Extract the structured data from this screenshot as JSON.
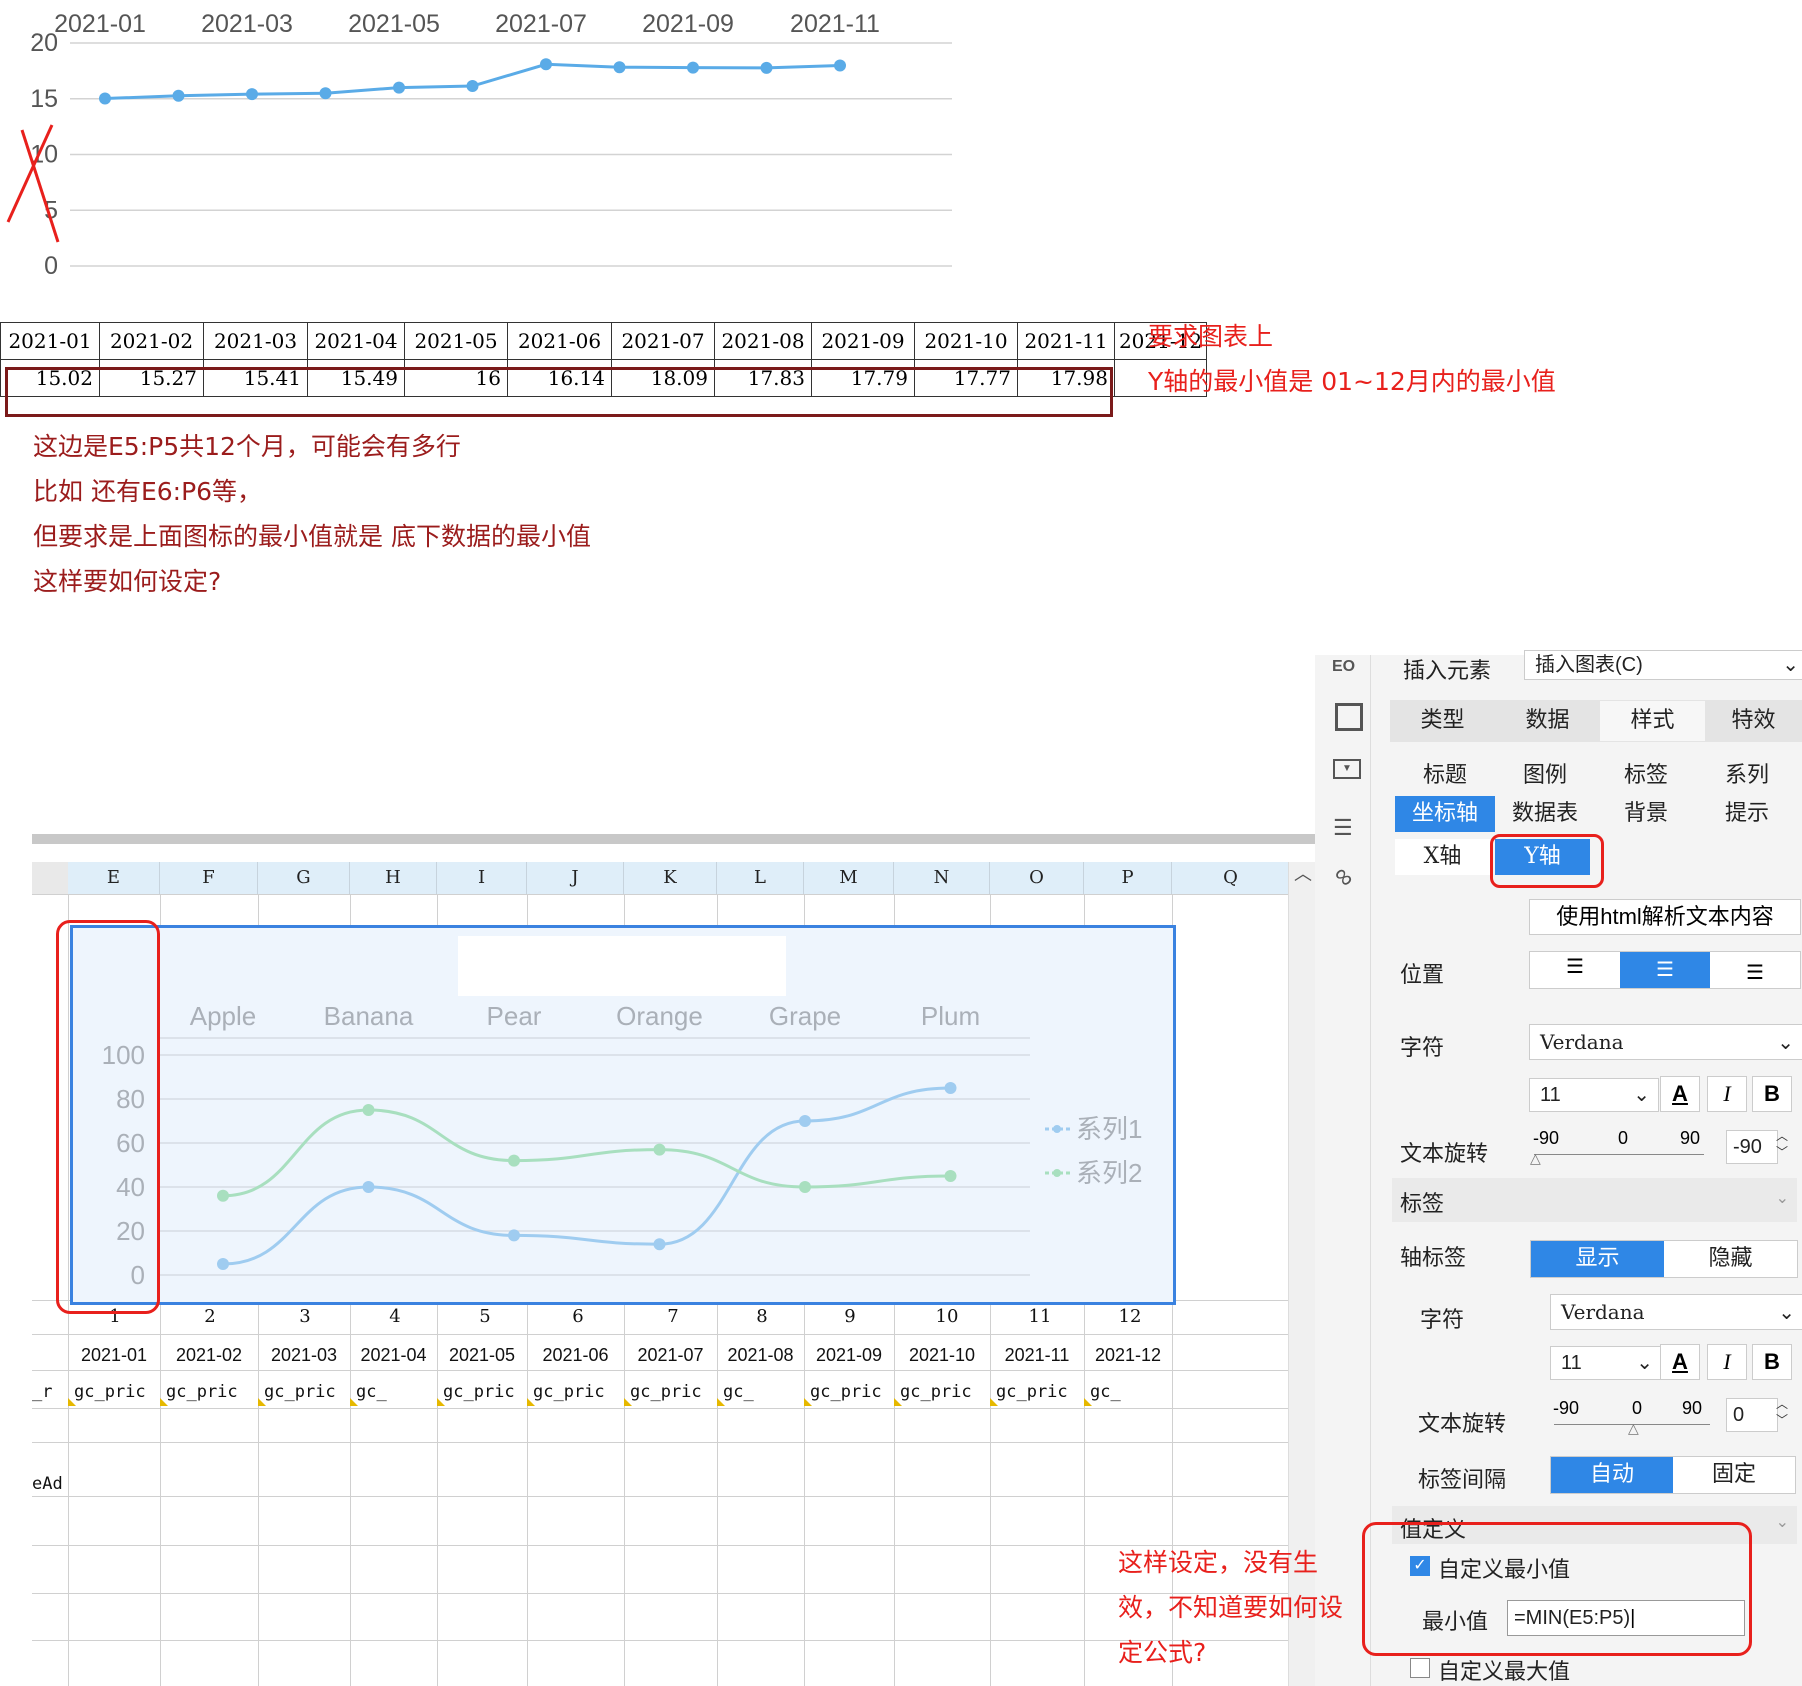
{
  "top_chart": {
    "x_tick_labels": [
      "2021-01",
      "2021-03",
      "2021-05",
      "2021-07",
      "2021-09",
      "2021-11"
    ],
    "y_tick_labels": [
      "20",
      "15",
      "10",
      "5",
      "0"
    ],
    "bottom_numbers": [
      "1",
      "2",
      "3",
      "4",
      "5",
      "6",
      "7",
      "8",
      "9",
      "10",
      "11",
      "12"
    ]
  },
  "chart_data": [
    {
      "type": "line",
      "categories": [
        "2021-01",
        "2021-02",
        "2021-03",
        "2021-04",
        "2021-05",
        "2021-06",
        "2021-07",
        "2021-08",
        "2021-09",
        "2021-10",
        "2021-11",
        "2021-12"
      ],
      "series": [
        {
          "values": [
            15.02,
            15.27,
            15.41,
            15.49,
            16,
            16.14,
            18.09,
            17.83,
            17.79,
            17.77,
            17.98,
            null
          ]
        }
      ],
      "ylim": [
        0,
        20
      ],
      "grid": true,
      "color": "#5aabe7"
    },
    {
      "type": "line",
      "categories": [
        "Apple",
        "Banana",
        "Pear",
        "Orange",
        "Grape",
        "Plum"
      ],
      "series": [
        {
          "name": "系列1",
          "values": [
            5,
            40,
            18,
            14,
            70,
            85
          ],
          "color": "#9fccf0"
        },
        {
          "name": "系列2",
          "values": [
            36,
            75,
            52,
            57,
            40,
            45
          ],
          "color": "#a8dfbf"
        }
      ],
      "yticks": [
        "100",
        "80",
        "60",
        "40",
        "20",
        "0"
      ],
      "ylim": [
        0,
        100
      ],
      "grid": true,
      "legend": "right"
    }
  ],
  "top_table": {
    "dates": [
      "2021-01",
      "2021-02",
      "2021-03",
      "2021-04",
      "2021-05",
      "2021-06",
      "2021-07",
      "2021-08",
      "2021-09",
      "2021-10",
      "2021-11",
      "2021-12"
    ],
    "values": [
      "15.02",
      "15.27",
      "15.41",
      "15.49",
      "16",
      "16.14",
      "18.09",
      "17.83",
      "17.79",
      "17.77",
      "17.98",
      ""
    ]
  },
  "notes": {
    "right_line1": "要求图表上",
    "right_line2": "Y轴的最小值是 01~12月内的最小值",
    "left_line1": "这边是E5:P5共12个月，可能会有多行",
    "left_line2": "比如 还有E6:P6等，",
    "left_line3": "但要求是上面图标的最小值就是 底下数据的最小值",
    "left_line4": "这样要如何设定?",
    "bottom_line1": "这样设定，没有生",
    "bottom_line2": "效，不知道要如何设",
    "bottom_line3": "定公式?"
  },
  "sheet": {
    "columns": [
      "E",
      "F",
      "G",
      "H",
      "I",
      "J",
      "K",
      "L",
      "M",
      "N",
      "O",
      "P",
      "Q"
    ],
    "row_numbers": [
      "1",
      "2",
      "3",
      "4",
      "5",
      "6",
      "7",
      "8",
      "9",
      "10",
      "11",
      "12"
    ],
    "dates": [
      "2021-01",
      "2021-02",
      "2021-03",
      "2021-04",
      "2021-05",
      "2021-06",
      "2021-07",
      "2021-08",
      "2021-09",
      "2021-10",
      "2021-11",
      "2021-12"
    ],
    "formula_cells": [
      "gc_pric",
      "gc_pric",
      "gc_pric",
      "gc_",
      "gc_pric",
      "gc_pric",
      "gc_pric",
      "gc_",
      "gc_pric",
      "gc_pric",
      "gc_pric",
      "gc_"
    ],
    "left_cut_cell": "_r",
    "left_cut_cell2": "eAd"
  },
  "panel": {
    "insert_element_label": "插入元素",
    "insert_chart_value": "插入图表(C)",
    "main_tabs": [
      "类型",
      "数据",
      "样式",
      "特效"
    ],
    "sub_tabs_row1": [
      "标题",
      "图例",
      "标签",
      "系列"
    ],
    "sub_tabs_row2": [
      "坐标轴",
      "数据表",
      "背景",
      "提示"
    ],
    "axis_tabs": [
      "X轴",
      "Y轴"
    ],
    "html_parse": "使用html解析文本内容",
    "position_label": "位置",
    "font_label": "字符",
    "font_value": "Verdana",
    "font_size": "11",
    "rotate_label": "文本旋转",
    "rotate_ticks": [
      "-90",
      "0",
      "90"
    ],
    "rotate_value": "-90",
    "label_section": "标签",
    "axis_label": "轴标签",
    "show": "显示",
    "hide": "隐藏",
    "font_label2": "字符",
    "font_value2": "Verdana",
    "font_size2": "11",
    "rotate_label2": "文本旋转",
    "rotate_value2": "0",
    "label_interval": "标签间隔",
    "auto": "自动",
    "fixed": "固定",
    "value_def": "值定义",
    "custom_min": "自定义最小值",
    "min_label": "最小值",
    "min_value": "=MIN(E5:P5)",
    "custom_max": "自定义最大值",
    "bold": "B",
    "italic": "I",
    "font_color": "A"
  },
  "colors": {
    "accent": "#2f87e6",
    "red": "#e8201c",
    "darkred": "#9b1c1c"
  }
}
